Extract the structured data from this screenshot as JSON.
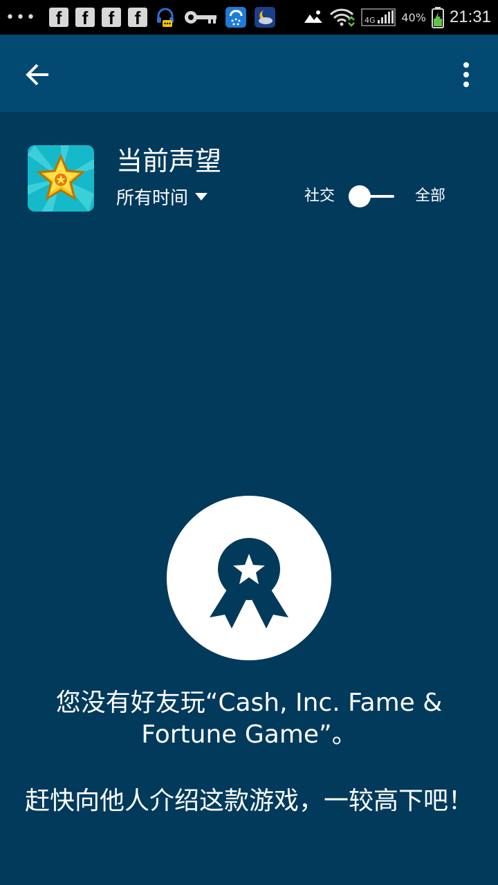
{
  "status_bar": {
    "overflow_dots": "•••",
    "notification_icons": [
      "facebook-icon",
      "facebook-icon",
      "facebook-icon",
      "facebook-icon",
      "headset-chat-icon",
      "key-icon",
      "snow-app-icon",
      "weather-night-icon"
    ],
    "battery_percent": "40%",
    "network": "4G",
    "time": "21:31"
  },
  "app_bar": {
    "back_icon": "arrow-left-icon",
    "menu_icon": "more-vert-icon",
    "color": "#034a73"
  },
  "header": {
    "title": "当前声望",
    "time_filter": "所有时间",
    "toggle_left_label": "社交",
    "toggle_right_label": "全部",
    "game_icon": "star-game-icon"
  },
  "empty_state": {
    "icon": "award-ribbon-icon",
    "message_1": "您没有好友玩“Cash, Inc. Fame & Fortune Game”。",
    "message_2": "赶快向他人介绍这款游戏，一较高下吧！"
  },
  "colors": {
    "background": "#023a5c",
    "app_bar": "#034a73",
    "foreground": "#ffffff"
  }
}
